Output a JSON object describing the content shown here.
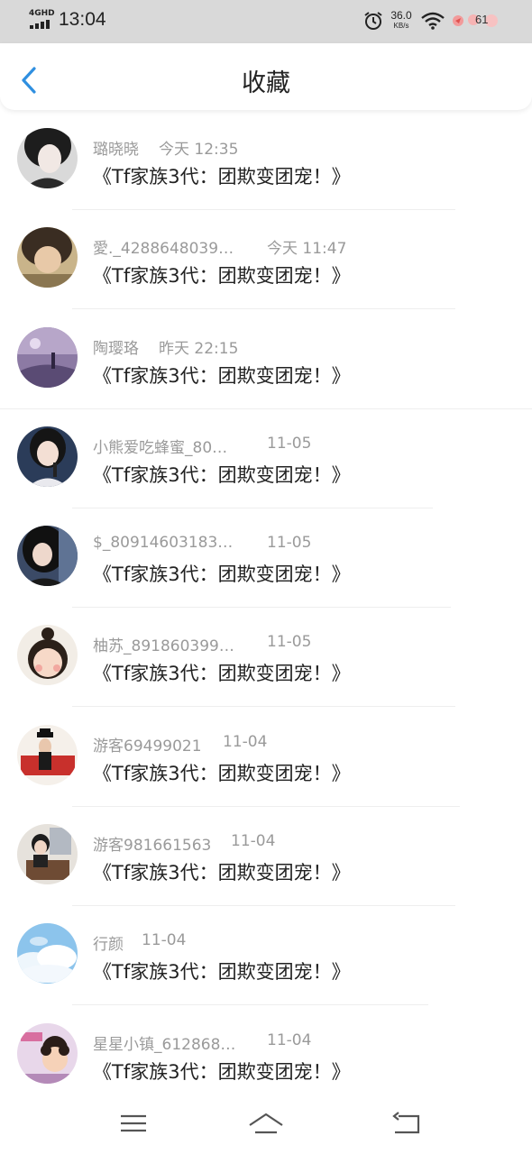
{
  "status_bar": {
    "network": "4GHD",
    "time": "13:04",
    "speed_value": "36.0",
    "speed_unit": "KB/s",
    "battery": "61"
  },
  "header": {
    "title": "收藏",
    "back_icon": "chevron-left-icon",
    "accent": "#2f8fe0"
  },
  "favorites": [
    {
      "user": "璐晓晓",
      "time": "今天 12:35",
      "title": "《Tf家族3代：团欺变团宠！》"
    },
    {
      "user": "愛._4288648039…",
      "time": "今天 11:47",
      "title": "《Tf家族3代：团欺变团宠！》"
    },
    {
      "user": "陶璎珞",
      "time": "昨天 22:15",
      "title": "《Tf家族3代：团欺变团宠！》"
    },
    {
      "user": "小熊爱吃蜂蜜_80…",
      "time": "11-05",
      "title": "《Tf家族3代：团欺变团宠！》"
    },
    {
      "user": "$_80914603183…",
      "time": "11-05",
      "title": "《Tf家族3代：团欺变团宠！》"
    },
    {
      "user": "柚苏_891860399…",
      "time": "11-05",
      "title": "《Tf家族3代：团欺变团宠！》"
    },
    {
      "user": "游客69499021",
      "time": "11-04",
      "title": "《Tf家族3代：团欺变团宠！》"
    },
    {
      "user": "游客981661563",
      "time": "11-04",
      "title": "《Tf家族3代：团欺变团宠！》"
    },
    {
      "user": "行颜",
      "time": "11-04",
      "title": "《Tf家族3代：团欺变团宠！》"
    },
    {
      "user": "星星小镇_612868…",
      "time": "11-04",
      "title": "《Tf家族3代：团欺变团宠！》"
    }
  ],
  "nav_bar": {
    "menu_icon": "menu-icon",
    "home_icon": "home-icon",
    "back_icon": "back-icon"
  }
}
